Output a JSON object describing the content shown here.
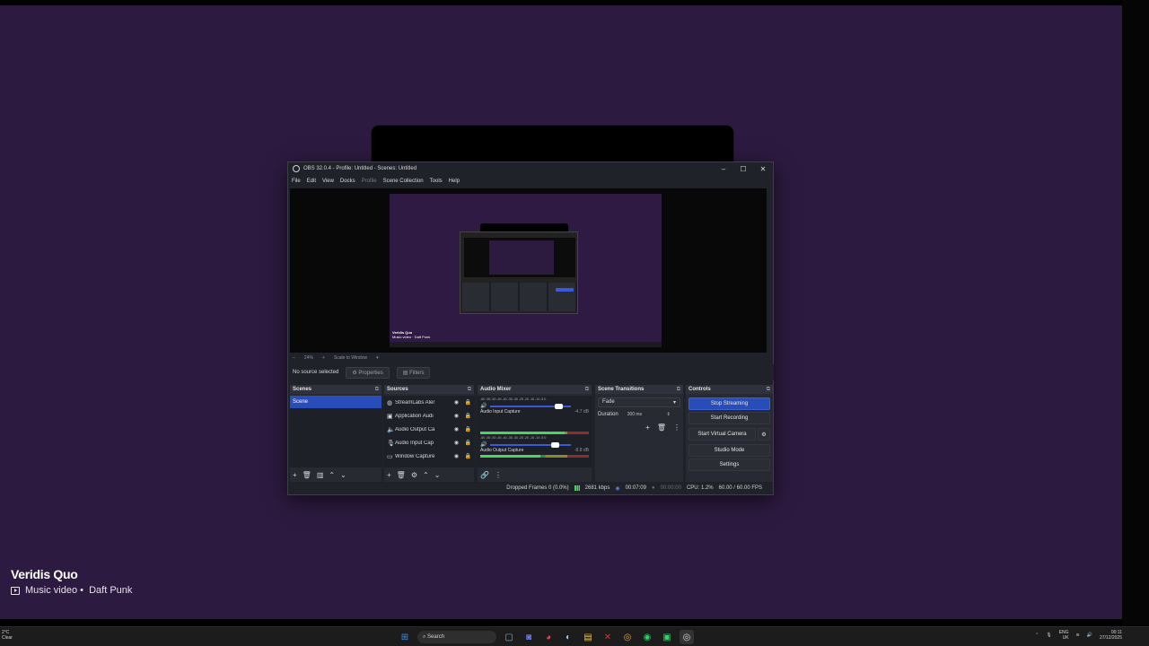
{
  "obs": {
    "window_title": "OBS 32.0.4 - Profile: Untitled - Scenes: Untitled",
    "menu": [
      "File",
      "Edit",
      "View",
      "Docks",
      "Profile",
      "Scene Collection",
      "Tools",
      "Help"
    ],
    "preview_bar": {
      "zoom": "24%",
      "scale_mode": "Scale to Window"
    },
    "props_bar": {
      "status": "No source selected",
      "properties": "Properties",
      "filters": "Filters"
    },
    "scenes": {
      "title": "Scenes",
      "items": [
        "Scene"
      ]
    },
    "sources": {
      "title": "Sources",
      "items": [
        {
          "icon": "globe-icon",
          "name": "StreamLabs Aler"
        },
        {
          "icon": "app-icon",
          "name": "Application Audi"
        },
        {
          "icon": "speaker-icon",
          "name": "Audio Output Ca"
        },
        {
          "icon": "mic-icon",
          "name": "Audio Input Cap"
        },
        {
          "icon": "window-icon",
          "name": "Window Capture"
        }
      ]
    },
    "mixer": {
      "title": "Audio Mixer",
      "ticks": "-60 -55 -50 -45 -40 -35 -30 -25 -20 -15 -10 -5 0",
      "tracks": [
        {
          "name": "Audio Input Capture",
          "db": "-4.7 dB",
          "level": 0.78,
          "volume": 0.9
        },
        {
          "name": "Audio Output Capture",
          "db": "-8.8 dB",
          "level": 0.55,
          "volume": 0.85
        }
      ]
    },
    "transitions": {
      "title": "Scene Transitions",
      "type": "Fade",
      "duration_label": "Duration",
      "duration": "300 ms"
    },
    "controls": {
      "title": "Controls",
      "buttons": [
        "Stop Streaming",
        "Start Recording",
        "Start Virtual Camera",
        "Studio Mode",
        "Settings"
      ]
    },
    "status": {
      "dropped": "Dropped Frames 0 (0.0%)",
      "bitrate": "2681 kbps",
      "stream_time": "00:07:09",
      "rec_time": "00:00:00",
      "cpu": "CPU: 1.2%",
      "fps": "60.00 / 60.00 FPS"
    }
  },
  "now_playing": {
    "title": "Veridis Quo",
    "type": "Music video",
    "artist": "Daft Punk"
  },
  "mini_caption": {
    "title": "Veridis Quo",
    "sub": "Music video · Daft Punk"
  },
  "taskbar": {
    "weather": {
      "temp": "2°C",
      "cond": "Clear"
    },
    "search_label": "Search",
    "lang": {
      "top": "ENG",
      "bottom": "UK"
    },
    "time": "00:11",
    "date": "27/12/2025"
  }
}
